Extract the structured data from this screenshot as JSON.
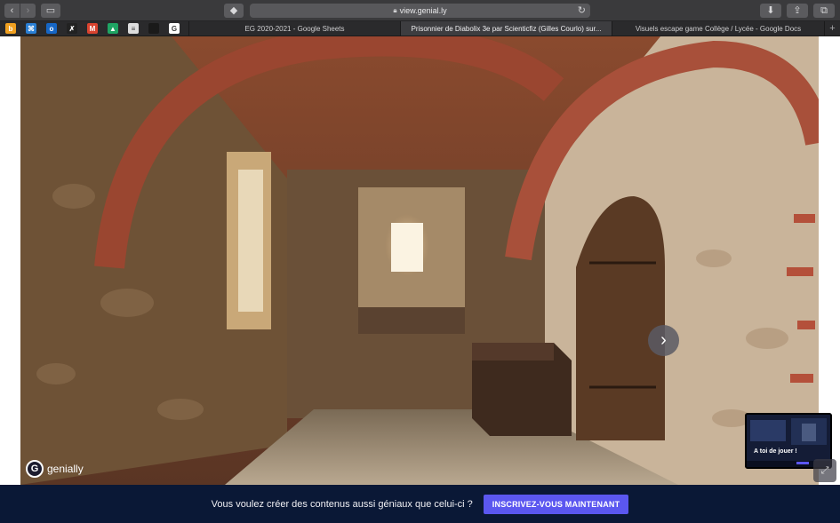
{
  "browser": {
    "url": "view.genial.ly",
    "nav": {
      "back_icon": "‹",
      "forward_icon": "›"
    },
    "toolbar_icons": {
      "sidebar": "▭",
      "tag": "◆",
      "download": "⬇",
      "share": "⇪",
      "tabs": "⧉"
    },
    "reload_icon": "↻",
    "favorites": [
      {
        "name": "bookmark-1",
        "glyph": "b",
        "color": "#f0a020"
      },
      {
        "name": "bookmark-2",
        "glyph": "⌘",
        "color": "#2a7fd4"
      },
      {
        "name": "bookmark-outlook",
        "glyph": "o",
        "color": "#1666c5"
      },
      {
        "name": "bookmark-4",
        "glyph": "✗",
        "color": "#222222"
      },
      {
        "name": "bookmark-gmail",
        "glyph": "M",
        "color": "#d9432f"
      },
      {
        "name": "bookmark-drive",
        "glyph": "▲",
        "color": "#1fa463"
      },
      {
        "name": "bookmark-7",
        "glyph": "≡",
        "color": "#dddddd"
      },
      {
        "name": "bookmark-8",
        "glyph": "",
        "color": "#1a1a1a"
      },
      {
        "name": "bookmark-google",
        "glyph": "G",
        "color": "#ffffff"
      }
    ],
    "tabs": [
      {
        "label": "EG 2020-2021 - Google Sheets",
        "active": false
      },
      {
        "label": "Prisonnier de Diabolix 3e par Scienticfiz (Gilles Courlo) sur...",
        "active": true
      },
      {
        "label": "Visuels escape game Collège / Lycée - Google Docs",
        "active": false
      }
    ],
    "new_tab_icon": "+"
  },
  "presentation": {
    "next_icon": "›",
    "brand": "genially",
    "brand_mark": "G",
    "thumbnail_label": "A toi de jouer !",
    "corner_icon": "⤢"
  },
  "banner": {
    "text": "Vous voulez créer des contenus aussi géniaux que celui-ci ?",
    "button": "INSCRIVEZ-VOUS MAINTENANT"
  }
}
